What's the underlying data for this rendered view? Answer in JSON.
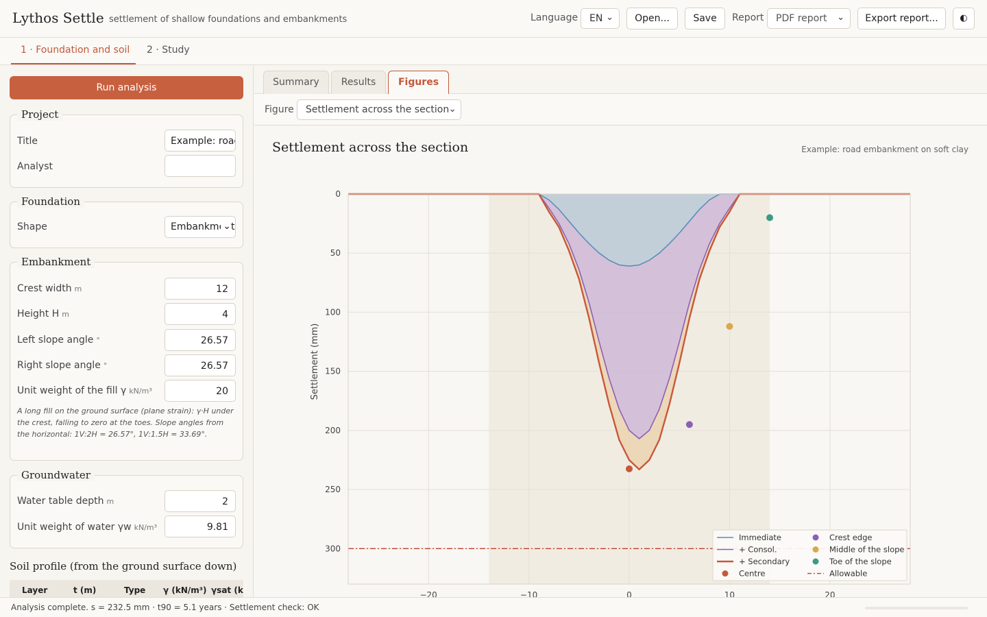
{
  "header": {
    "app_title": "Lythos Settle",
    "app_subtitle": "settlement of shallow foundations and embankments",
    "language_label": "Language",
    "language_value": "EN",
    "open_label": "Open...",
    "save_label": "Save",
    "report_label": "Report",
    "report_value": "PDF report",
    "export_label": "Export report...",
    "theme_icon": "◐"
  },
  "top_tabs": [
    {
      "label": "1 · Foundation and soil",
      "active": true
    },
    {
      "label": "2 · Study",
      "active": false
    }
  ],
  "sidebar": {
    "run_label": "Run analysis",
    "project": {
      "legend": "Project",
      "title_label": "Title",
      "title_value": "Example: road embankment on soft clay",
      "analyst_label": "Analyst",
      "analyst_value": ""
    },
    "foundation": {
      "legend": "Foundation",
      "shape_label": "Shape",
      "shape_value": "Embankment"
    },
    "embankment": {
      "legend": "Embankment",
      "fields": [
        {
          "label": "Crest width",
          "unit": "m",
          "value": "12"
        },
        {
          "label": "Height H",
          "unit": "m",
          "value": "4"
        },
        {
          "label": "Left slope angle",
          "unit": "°",
          "value": "26.57"
        },
        {
          "label": "Right slope angle",
          "unit": "°",
          "value": "26.57"
        },
        {
          "label": "Unit weight of the fill γ",
          "unit": "kN/m³",
          "value": "20"
        }
      ],
      "note": "A long fill on the ground surface (plane strain): γ·H under the crest, falling to zero at the toes. Slope angles from the horizontal: 1V:2H = 26.57°, 1V:1.5H = 33.69°."
    },
    "groundwater": {
      "legend": "Groundwater",
      "fields": [
        {
          "label": "Water table depth",
          "unit": "m",
          "value": "2"
        },
        {
          "label": "Unit weight of water γw",
          "unit": "kN/m³",
          "value": "9.81"
        }
      ]
    },
    "soil": {
      "title": "Soil profile (from the ground surface down)",
      "columns": [
        "Layer",
        "t (m)",
        "Type",
        "γ (kN/m³)",
        "γsat (k"
      ]
    }
  },
  "main": {
    "tabs": [
      {
        "label": "Summary",
        "active": false
      },
      {
        "label": "Results",
        "active": false
      },
      {
        "label": "Figures",
        "active": true
      }
    ],
    "figure_label": "Figure",
    "figure_value": "Settlement across the section"
  },
  "chart_data": {
    "type": "line",
    "title": "Settlement across the section",
    "subtitle": "Example: road embankment on soft clay",
    "ylabel": "Settlement (mm)",
    "xlim": [
      -28,
      28
    ],
    "ylim": [
      330,
      0
    ],
    "xticks": [
      -20,
      -10,
      0,
      10,
      20
    ],
    "yticks": [
      0,
      50,
      100,
      150,
      200,
      250,
      300
    ],
    "grid": true,
    "footprint_band": [
      -14,
      14
    ],
    "colors": {
      "immediate": "#5b8db8",
      "consol": "#8d5fb5",
      "secondary": "#c7583a",
      "crest": "#8d5fb5",
      "middle": "#d9a84c",
      "toe": "#3d9a86",
      "allowable": "#c44a3a"
    },
    "x": [
      -28,
      -26,
      -24,
      -22,
      -20,
      -18,
      -16,
      -15,
      -14,
      -13,
      -12,
      -11,
      -10,
      -9,
      -8,
      -7,
      -6,
      -5,
      -4,
      -3,
      -2,
      -1,
      0,
      1,
      2,
      3,
      4,
      5,
      6,
      7,
      8,
      9,
      10,
      11,
      12,
      13,
      14,
      15,
      16,
      18,
      20,
      22,
      24,
      26,
      28
    ],
    "series": [
      {
        "name": "Immediate",
        "values": [
          0,
          0,
          0,
          0,
          0,
          0,
          0,
          0,
          0,
          0,
          0,
          0,
          0,
          0,
          5,
          13,
          23,
          33,
          42,
          50,
          56,
          60,
          61,
          60,
          56,
          50,
          42,
          33,
          23,
          13,
          5,
          0,
          0,
          0,
          0,
          0,
          0,
          0,
          0,
          0,
          0,
          0,
          0,
          0,
          0
        ]
      },
      {
        "name": "+ Consol.",
        "values": [
          0,
          0,
          0,
          0,
          0,
          0,
          0,
          0,
          0,
          0,
          0,
          0,
          0,
          0,
          12,
          25,
          42,
          64,
          92,
          125,
          156,
          182,
          200,
          207,
          200,
          182,
          156,
          125,
          92,
          64,
          42,
          25,
          12,
          0,
          0,
          0,
          0,
          0,
          0,
          0,
          0,
          0,
          0,
          0,
          0
        ]
      },
      {
        "name": "+ Secondary",
        "values": [
          0,
          0,
          0,
          0,
          0,
          0,
          0,
          0,
          0,
          0,
          0,
          0,
          0,
          0,
          15,
          28,
          48,
          72,
          105,
          143,
          178,
          208,
          225,
          233,
          225,
          208,
          178,
          143,
          105,
          72,
          48,
          28,
          15,
          0,
          0,
          0,
          0,
          0,
          0,
          0,
          0,
          0,
          0,
          0,
          0
        ]
      }
    ],
    "points": [
      {
        "name": "Centre",
        "x": 0,
        "y": 232.5
      },
      {
        "name": "Crest edge",
        "x": 6,
        "y": 195
      },
      {
        "name": "Middle of the slope",
        "x": 10,
        "y": 112
      },
      {
        "name": "Toe of the slope",
        "x": 14,
        "y": 20
      }
    ],
    "allowable": {
      "name": "Allowable",
      "y": 300
    },
    "legend": {
      "placement": "bottom-right",
      "items": [
        "Immediate",
        "+ Consol.",
        "+ Secondary",
        "Centre",
        "Crest edge",
        "Middle of the slope",
        "Toe of the slope",
        "Allowable"
      ]
    }
  },
  "status": {
    "text": "Analysis complete. s = 232.5 mm · t90 = 5.1 years · Settlement check: OK"
  }
}
